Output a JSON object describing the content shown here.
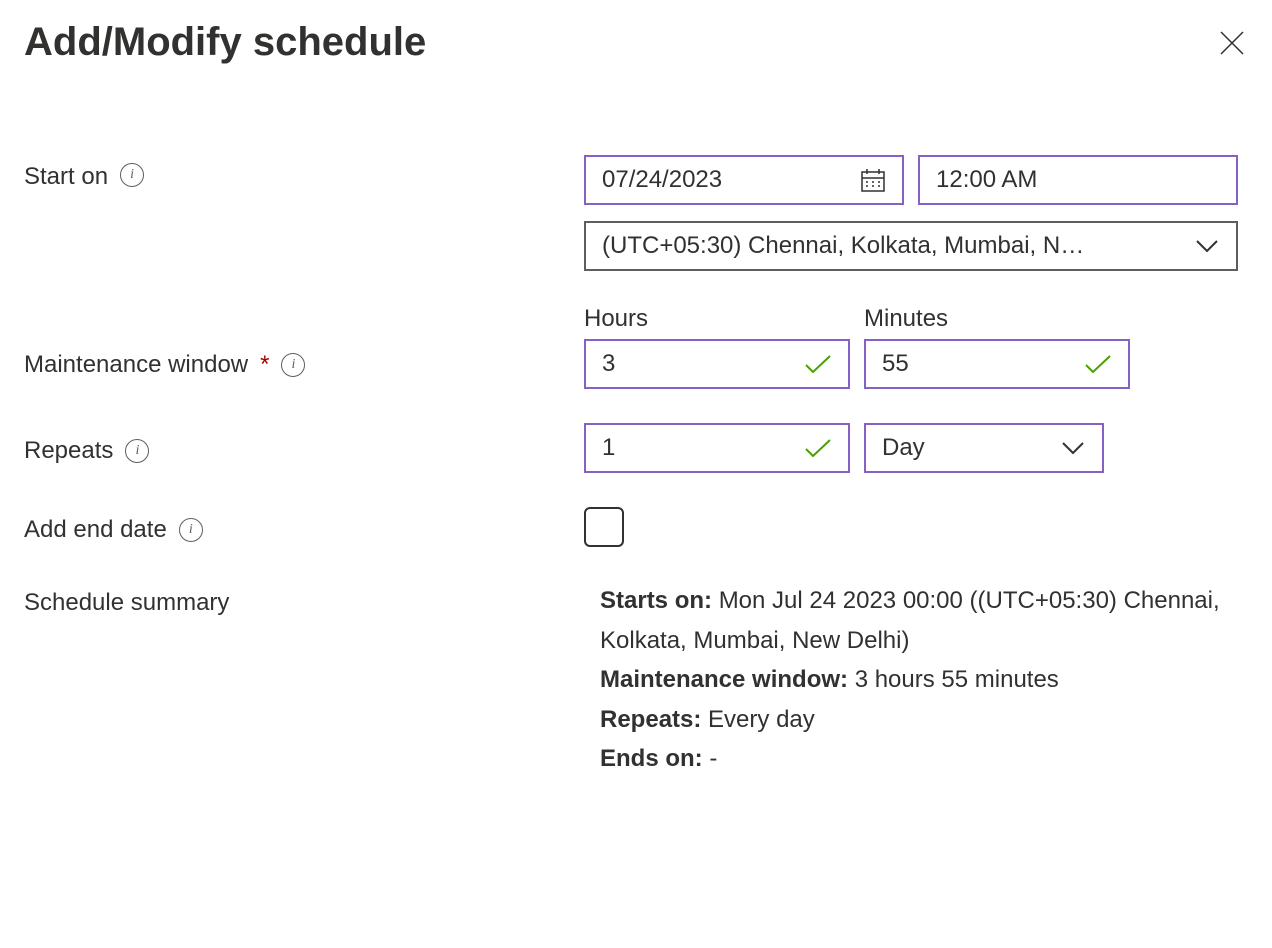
{
  "title": "Add/Modify schedule",
  "labels": {
    "start_on": "Start on",
    "maintenance_window": "Maintenance window",
    "repeats": "Repeats",
    "add_end_date": "Add end date",
    "schedule_summary": "Schedule summary",
    "hours": "Hours",
    "minutes": "Minutes"
  },
  "fields": {
    "date": "07/24/2023",
    "time": "12:00 AM",
    "timezone": "(UTC+05:30) Chennai, Kolkata, Mumbai, N…",
    "hours": "3",
    "minutes": "55",
    "repeat_count": "1",
    "repeat_unit": "Day"
  },
  "summary": {
    "starts_on_label": "Starts on:",
    "starts_on_value": "Mon Jul 24 2023 00:00 ((UTC+05:30) Chennai, Kolkata, Mumbai, New Delhi)",
    "mw_label": "Maintenance window:",
    "mw_value": "3 hours 55 minutes",
    "repeats_label": "Repeats:",
    "repeats_value": "Every day",
    "ends_on_label": "Ends on:",
    "ends_on_value": "-"
  }
}
